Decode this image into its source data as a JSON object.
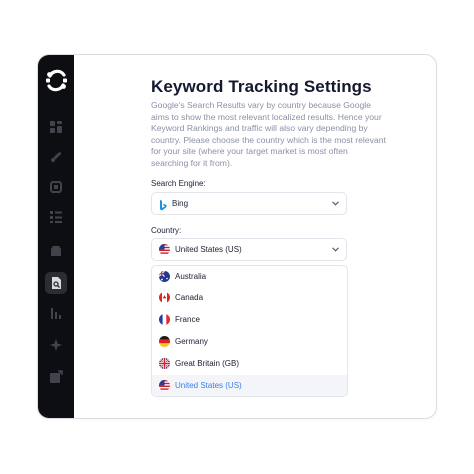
{
  "page": {
    "title": "Keyword Tracking Settings",
    "description": "Google's Search Results vary by country because Google aims to show the most relevant localized results. Hence your Keyword Rankings and traffic will also vary depending by country. Please choose the country which is the most relevant for your site (where your target market is most often searching for it from)."
  },
  "sidebar": {
    "logo_icon": "logo-icon",
    "items": [
      {
        "icon": "dashboard-icon"
      },
      {
        "icon": "rocket-icon"
      },
      {
        "icon": "cube-icon"
      },
      {
        "icon": "checklist-icon"
      },
      {
        "icon": "inbox-icon"
      },
      {
        "icon": "page-search-icon",
        "active": true
      },
      {
        "icon": "bar-chart-icon"
      },
      {
        "icon": "sparkle-icon"
      },
      {
        "icon": "external-link-icon"
      }
    ]
  },
  "search_engine": {
    "label": "Search Engine:",
    "value": "Bing",
    "icon": "bing-icon"
  },
  "country": {
    "label": "Country:",
    "value": "United States (US)",
    "options": [
      {
        "label": "Australia",
        "flag": "australia-flag-icon"
      },
      {
        "label": "Canada",
        "flag": "canada-flag-icon"
      },
      {
        "label": "France",
        "flag": "france-flag-icon"
      },
      {
        "label": "Germany",
        "flag": "germany-flag-icon"
      },
      {
        "label": "Great Britain (GB)",
        "flag": "great-britain-flag-icon"
      },
      {
        "label": "United States (US)",
        "flag": "usa-flag-icon",
        "selected": true
      }
    ]
  },
  "colors": {
    "sidebar_bg": "#0d0e12",
    "title": "#141a2e",
    "muted_text": "#8a90a6",
    "selected_text": "#3b7de8",
    "border": "#e3e5ec"
  }
}
